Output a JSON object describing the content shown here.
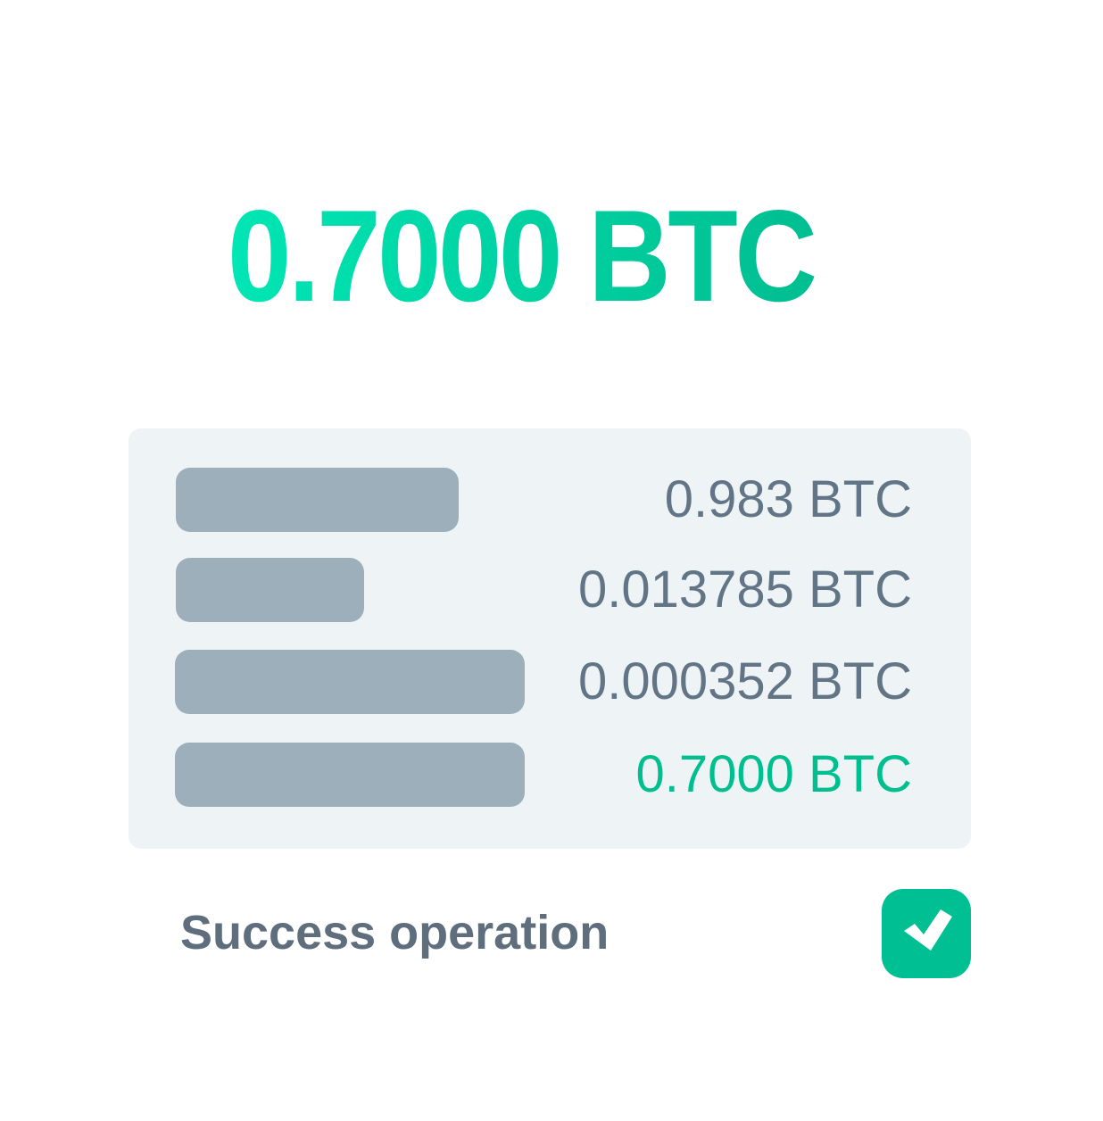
{
  "headline": {
    "amount": "0.7000 BTC"
  },
  "breakdown": {
    "rows": [
      {
        "value": "0.983 BTC",
        "bar_fill": 0.34,
        "highlight": false
      },
      {
        "value": "0.013785 BTC",
        "bar_fill": 0.22,
        "highlight": false
      },
      {
        "value": "0.000352 BTC",
        "bar_fill": 0.42,
        "highlight": false
      },
      {
        "value": "0.7000 BTC",
        "bar_fill": 0.42,
        "highlight": true
      }
    ]
  },
  "status": {
    "label": "Success operation",
    "icon": "checkmark-icon"
  },
  "colors": {
    "accent": "#00bf93",
    "accent_light": "#00e6b4",
    "bar": "#9eafbc",
    "card": "#eef3f6",
    "text": "#627586"
  }
}
